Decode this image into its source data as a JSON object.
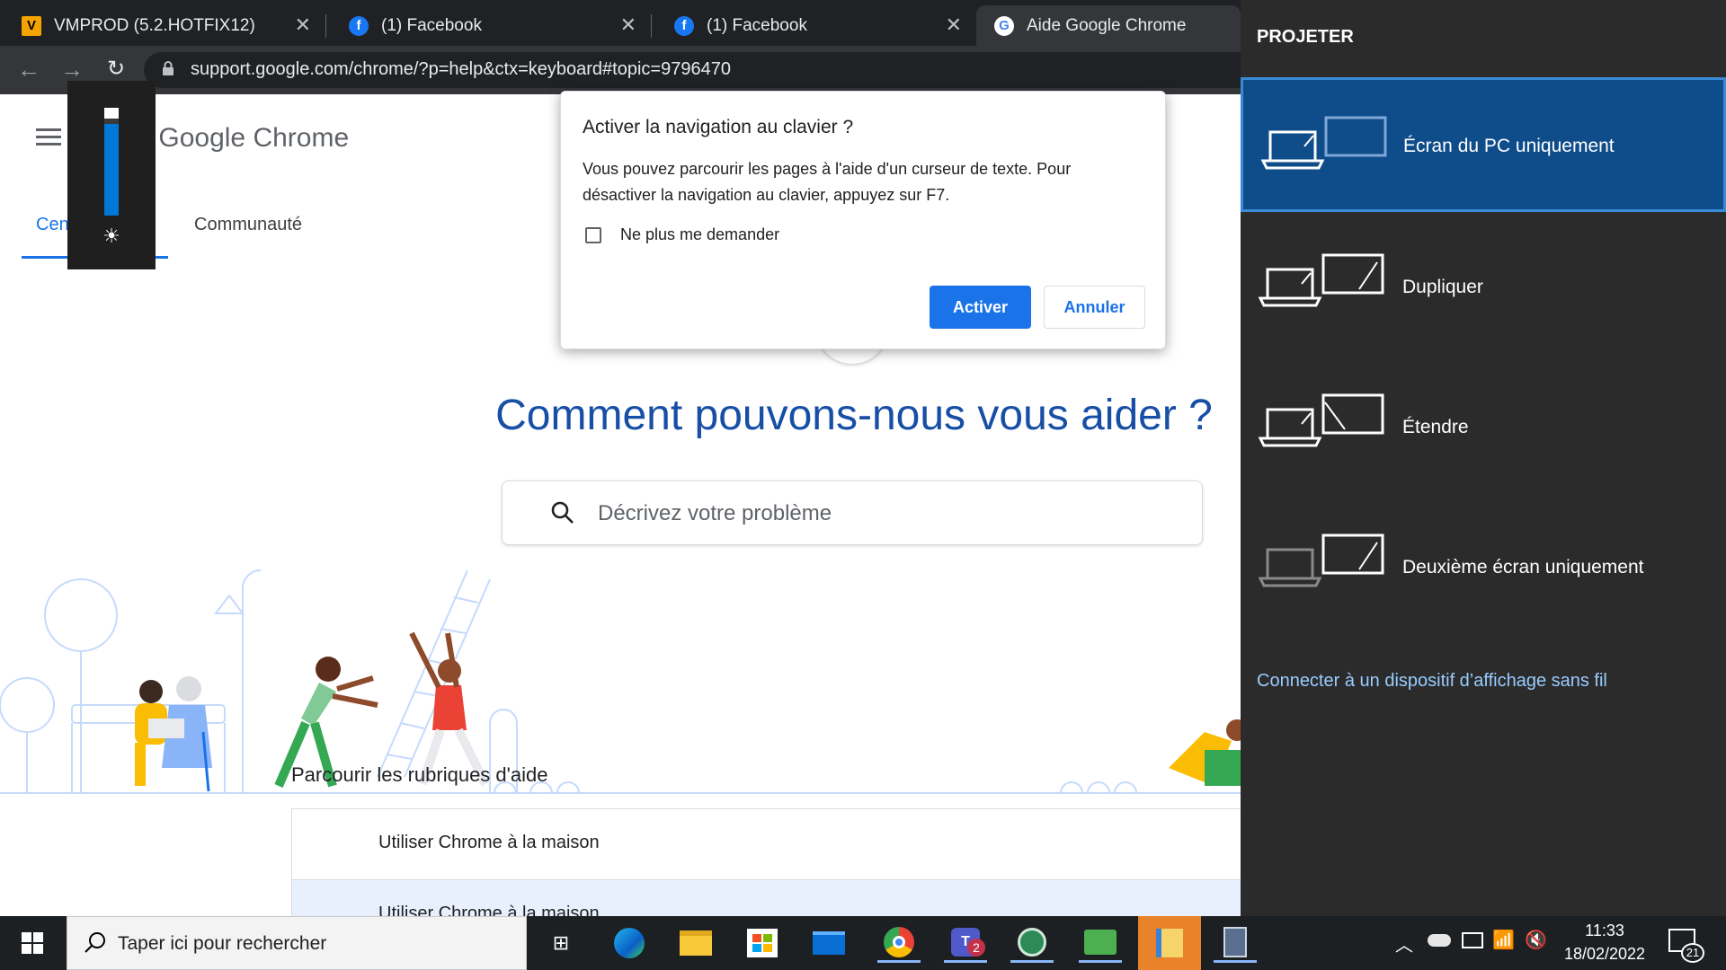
{
  "browser": {
    "tabs": [
      {
        "title": "VMPROD (5.2.HOTFIX12)",
        "favicon": "vmprod-icon"
      },
      {
        "title": "(1) Facebook",
        "favicon": "facebook-icon"
      },
      {
        "title": "(1) Facebook",
        "favicon": "facebook-icon"
      },
      {
        "title": "Aide Google Chrome",
        "favicon": "google-icon"
      }
    ],
    "url": "support.google.com/chrome/?p=help&ctx=keyboard#topic=9796470"
  },
  "page": {
    "logo_text": "Aide Google Chrome",
    "tabs": [
      "Centre d'aide",
      "Communauté"
    ],
    "heading": "Comment pouvons-nous vous aider ?",
    "search_placeholder": "Décrivez votre problème",
    "browse_title": "Parcourir les rubriques d'aide",
    "topics": [
      "Utiliser Chrome à la maison",
      "Utiliser Chrome à la maison"
    ]
  },
  "dialog": {
    "title": "Activer la navigation au clavier ?",
    "body": "Vous pouvez parcourir les pages à l'aide d'un curseur de texte. Pour désactiver la navigation au clavier, appuyez sur F7.",
    "checkbox_label": "Ne plus me demander",
    "primary_button": "Activer",
    "secondary_button": "Annuler"
  },
  "brightness": {
    "level": 0.85
  },
  "projection": {
    "title": "PROJETER",
    "options": [
      {
        "label": "Écran du PC uniquement",
        "selected": true
      },
      {
        "label": "Dupliquer",
        "selected": false
      },
      {
        "label": "Étendre",
        "selected": false
      },
      {
        "label": "Deuxième écran uniquement",
        "selected": false
      }
    ],
    "wireless_link": "Connecter à un dispositif d’affichage sans fil"
  },
  "taskbar": {
    "search_placeholder": "Taper ici pour rechercher",
    "time": "11:33",
    "date": "18/02/2022",
    "teams_badge": "2",
    "notifications_count": "21"
  },
  "colors": {
    "accent_blue": "#1a73e8",
    "heading_blue": "#174ea6",
    "selected_option": "#0f4c8a",
    "link_blue": "#99ccff"
  }
}
